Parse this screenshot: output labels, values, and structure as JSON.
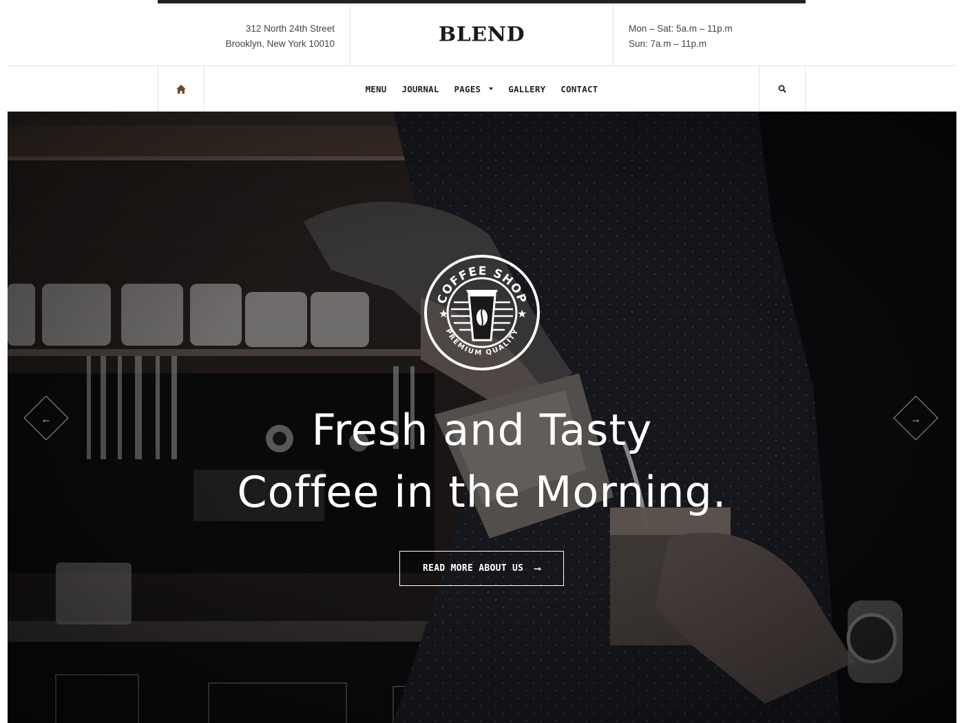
{
  "header": {
    "address_line1": "312 North 24th Street",
    "address_line2": "Brooklyn, New York 10010",
    "logo": "BLEND",
    "hours_line1": "Mon – Sat: 5a.m – 11p.m",
    "hours_line2": "Sun: 7a.m – 11p.m"
  },
  "nav": {
    "home_icon": "home-icon",
    "items": [
      {
        "label": "MENU"
      },
      {
        "label": "JOURNAL"
      },
      {
        "label": "PAGES",
        "has_dropdown": true
      },
      {
        "label": "GALLERY"
      },
      {
        "label": "CONTACT"
      }
    ],
    "search_icon": "search-icon"
  },
  "hero": {
    "badge_top": "COFFEE SHOP",
    "badge_bottom": "PREMIUM QUALITY",
    "headline_line1": "Fresh and Tasty",
    "headline_line2": "Coffee in the Morning.",
    "cta_label": "READ MORE ABOUT US",
    "cta_icon": "long-arrow-right-icon",
    "prev_icon": "arrow-left-icon",
    "next_icon": "arrow-right-icon"
  },
  "colors": {
    "accent": "#6b4a2b",
    "text_dark": "#222222",
    "border": "#e2e2e2",
    "hero_bg": "#151313"
  }
}
